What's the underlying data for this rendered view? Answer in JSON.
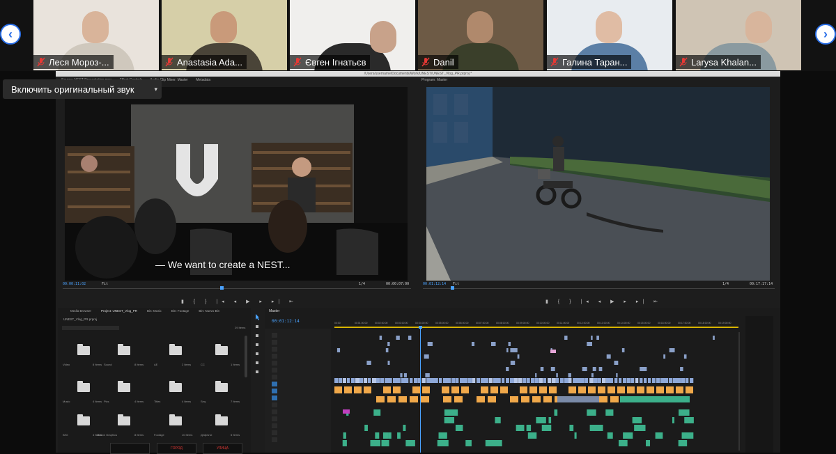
{
  "call": {
    "participants": [
      {
        "name": "Леся Мороз-...",
        "bg": "#e9e3dc",
        "face": "#d9b49a",
        "body": "#cfc8bd"
      },
      {
        "name": "Anastasia Ada...",
        "bg": "#d6cfa8",
        "face": "#c99a7a",
        "body": "#4a4438"
      },
      {
        "name": "Євген Ігнатьєв",
        "bg": "#f0efed",
        "face": "#c8a28a",
        "body": "#2a2a2a"
      },
      {
        "name": "Danil",
        "bg": "#6d5a45",
        "face": "#b0896c",
        "body": "#3a3f2a"
      },
      {
        "name": "Галина Таран...",
        "bg": "#e8ecf0",
        "face": "#e0bca4",
        "body": "#5b7fa6"
      },
      {
        "name": "Larysa Khalan...",
        "bg": "#cfc4b4",
        "face": "#d8b59c",
        "body": "#8a9aa0"
      }
    ],
    "prev_arrow": "‹",
    "next_arrow": "›",
    "original_audio_button": "Включить оригинальный звук",
    "caret": "▾"
  },
  "premiere": {
    "title_path": "/Users/username/Documents/Work/UNEST/UNEST_Vlog_PR.prproj *",
    "source_tabs": [
      "Source: NEST Presentation.mov",
      "Effect Controls",
      "Audio Clip Mixer: Master",
      "Metadata"
    ],
    "program_tab": "Program: Master",
    "subtitle": "— We want to create a NEST...",
    "source_tc_in": "00:00:11:02",
    "source_tc_out": "00:00:07:00",
    "program_tc_in": "00:01:12:14",
    "program_tc_out": "00:17:17:14",
    "fit_label": "Fit",
    "scale_label": "1/4",
    "transport_glyphs": "▮ { } |◂ ◂ ▶ ▸ ▸| ⇤",
    "project_tabs": [
      "Media Browser",
      "Project: UNEST_Vlog_PR",
      "Bin: Music",
      "Bin: Footage",
      "Bin: Nuevo Bin"
    ],
    "project_file": "UNEST_Vlog_PR.prproj",
    "items_count": "29 Items",
    "bins": [
      {
        "name": "Video",
        "count": "8 Items"
      },
      {
        "name": "Sound",
        "count": "8 Items"
      },
      {
        "name": "AE",
        "count": "2 Items"
      },
      {
        "name": "CC",
        "count": "1 Items"
      },
      {
        "name": "Music",
        "count": "4 Items"
      },
      {
        "name": "Pics",
        "count": "4 Items"
      },
      {
        "name": "Titles",
        "count": "4 Items"
      },
      {
        "name": "Seq",
        "count": "7 Items"
      },
      {
        "name": "IMG",
        "count": "4 Items"
      },
      {
        "name": "Motion Graphics",
        "count": "8 Items"
      },
      {
        "name": "Footage",
        "count": "10 Items"
      },
      {
        "name": "Дефекти",
        "count": "5 Items"
      }
    ],
    "timeline_tab": "Master",
    "timeline_tc": "00:01:12:14",
    "ruler": [
      "00:00",
      "00:01:00:00",
      "00:02:00:00",
      "00:03:00:00",
      "00:04:00:00",
      "00:05:00:00",
      "00:06:00:00",
      "00:07:00:00",
      "00:08:00:00",
      "00:09:00:00",
      "00:10:00:00",
      "00:11:00:00",
      "00:12:00:00",
      "00:13:00:00",
      "00:14:00:00",
      "00:15:00:00",
      "00:16:00:00",
      "00:17:00:00",
      "00:18:00:00",
      "00:19:00:00"
    ],
    "thumb_labels": [
      "ГОРОД",
      "УЛИЦА"
    ],
    "colors": {
      "video": "#8ea8d8",
      "audio_orange": "#f0a84a",
      "audio_green": "#3cb08a",
      "playhead": "#4aa3ff"
    }
  }
}
